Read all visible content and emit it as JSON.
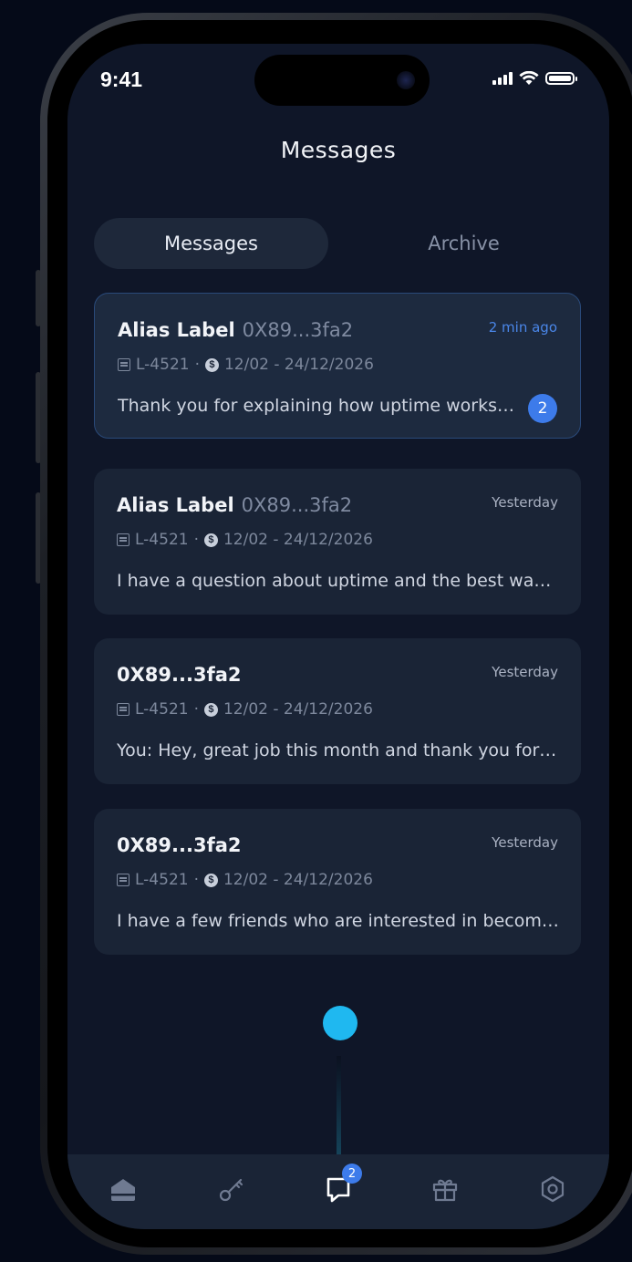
{
  "status_bar": {
    "time": "9:41"
  },
  "header": {
    "title": "Messages"
  },
  "tabs": [
    {
      "label": "Messages",
      "active": true
    },
    {
      "label": "Archive",
      "active": false
    }
  ],
  "conversations": [
    {
      "name": "Alias Label",
      "address": "0X89...3fa2",
      "time": "2 min ago",
      "lease": "L-4521",
      "separator": "·",
      "coin_symbol": "$",
      "dates": "12/02 - 24/12/2026",
      "preview": "Thank you for explaining how uptime works and why it matters",
      "unread": "2"
    },
    {
      "name": "Alias Label",
      "address": "0X89...3fa2",
      "time": "Yesterday",
      "lease": "L-4521",
      "separator": "·",
      "coin_symbol": "$",
      "dates": "12/02 - 24/12/2026",
      "preview": "I have a question about uptime and the best way to improve it"
    },
    {
      "name": "0X89...3fa2",
      "time": "Yesterday",
      "lease": "L-4521",
      "separator": "·",
      "coin_symbol": "$",
      "dates": "12/02 - 24/12/2026",
      "preview": "You: Hey, great job this month and thank you for everything"
    },
    {
      "name": "0X89...3fa2",
      "time": "Yesterday",
      "lease": "L-4521",
      "separator": "·",
      "coin_symbol": "$",
      "dates": "12/02 - 24/12/2026",
      "preview": "I have a few friends who are interested in becoming operators"
    }
  ],
  "bottom_nav": {
    "items": [
      {
        "icon": "home-icon"
      },
      {
        "icon": "key-icon"
      },
      {
        "icon": "chat-icon",
        "badge": "2",
        "active": true
      },
      {
        "icon": "gift-icon"
      },
      {
        "icon": "settings-icon"
      }
    ]
  },
  "colors": {
    "background": "#050a18",
    "screen": "#0f1628",
    "card": "#1a2436",
    "accent": "#3d7bea",
    "touch": "#1fb8f0"
  }
}
